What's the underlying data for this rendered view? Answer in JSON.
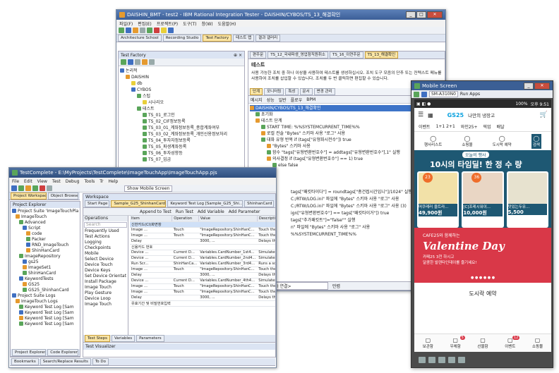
{
  "rit": {
    "title": "DAISHIN_BMT - test2 - IBM Rational Integration Tester - DAISHIN/CYBOS/TS_13_해결확인",
    "menu": [
      "파일(F)",
      "편집(E)",
      "프로젝트(P)",
      "도구(T)",
      "창(W)",
      "도움말(H)"
    ],
    "perspectives": [
      "Architecture School",
      "Recording Studio",
      "Test Factory",
      "테스트 랩",
      "결과 갤러리"
    ],
    "panel_title": "Test Factory",
    "tree": [
      "논리적",
      "DAISHIN",
      "db",
      "CYBOS",
      "스텁",
      "시나리오",
      "테스트",
      "TS_01_로그인",
      "TS_02_CIF정보등록",
      "TS_03_01_계좌정보등록_종합계좌여부",
      "TS_03_02_계좌정보등록_개인신용정보처리",
      "TS_04_투자자정보등록",
      "TS_05_파생계좌등록",
      "TS_06_투자성향등",
      "TS_07_입금"
    ],
    "doc_tabs": [
      "편주문",
      "TS_12_국내파생_영업점직원취소",
      "TS_16_이연주문",
      "TS_13_해결확인"
    ],
    "section_title": "테스트",
    "description": "사용 가능한 조치 중 하나 이상을 사용하여 테스트를 생성하십시오. 조치 도구 모음의 단추 또는 컨텍스트 메뉴를 사용하여 조치를 삽입할 수 있습니다. 조치를 두 번 클릭하면 편집할 수 있습니다.",
    "inner_tabs": [
      "단계",
      "모니터링",
      "특성",
      "문서",
      "변경 관리"
    ],
    "step_toolbar": [
      "메시지",
      "성능",
      "일반",
      "플로우",
      "BPM"
    ],
    "steps": [
      "DAISHIN/CYBOS/TS_13_해결확인",
      "초기화",
      "테스트 단계",
      "START TIME: %%SYSTEMCURRENT_TIME%%",
      "로컬 컨솔 \"Bytes\" 스키마 사용 \"로그\" 사용",
      "대화 유형 반복 if (tags[\"유형화시전수\"]) true",
      "\"Bytes\" 스키마 사용",
      "함수 \"tags[\"유형변환번호수\"] = addtags[\"유형변환번호수\"],1\" 실행",
      "의사결정 if (tags[\"유형변환번호수\"] == 1) true",
      "else false"
    ],
    "steps_right": [
      "tags[\"패킷타이다\"] = roundtags[\"총건접시간입니\"]/1024\" 실행",
      "C:/RTW/LOG.ini\" 파일에 \"Bytes\" 스키마 사용 \"로그\" 사용",
      "C:/RTW/LOG.ini\" 파일에 \"Bytes\" 스키마 사용 \"로그\" 사용 (3)",
      "ign[\"유형변환번호수\"] == tags[\"패킷타이거\"]) true",
      "tags[\"추가패킷트\"]=\"false\"\" 실행",
      "n\" 파일에 \"Bytes\" 스키마 사용 \"로그\" 사용",
      "%%SYSTEMCURRENT_TIME%%"
    ],
    "status_combo": "<테스트 추가 연결>",
    "status_right": "만렴"
  },
  "tc": {
    "title": "TestComplete - E:\\MyProjects\\TestComplete\\ImageTouchApp\\ImageTouchApp.pjs",
    "menu": [
      "File",
      "Edit",
      "View",
      "Test",
      "Debug",
      "Tools",
      "Tr",
      "Help"
    ],
    "left_tabs": [
      "Project Workspace",
      "Object Browser"
    ],
    "explorer_title": "Project Explorer",
    "tree": [
      "Project Suite 'ImageTouchPlay'",
      "ImageTouch",
      "Advanced",
      "Script",
      "code",
      "Packer",
      "RND_ImageTouch",
      "ShinHanCard",
      "ImageRepository",
      "gs25",
      "ImageSet1",
      "ShinHanCard",
      "KeywordTests",
      "GS25",
      "GS25_ShinhanCard",
      "Project Suite Logs",
      "ImageTouch Logs",
      "Keyword Test Log [Sam",
      "Keyword Test Log [Sam",
      "Keyword Test Log [Sam",
      "Keyword Test Log [Sam"
    ],
    "left_bottom_tabs": [
      "Project Explorer",
      "Code Explorer"
    ],
    "footer_tabs": [
      "Bookmarks",
      "Search/Replace Results",
      "To Do"
    ],
    "workspace_title": "Workspace",
    "doc_tabs": [
      "Start Page",
      "Sample_G25_ShinhanCard",
      "Keyword Test Log [Sample_G25_Shi...",
      "ShinhanCard"
    ],
    "toolbar": [
      "Append to Test",
      "Run Test",
      "Add Variable",
      "Add Parameter"
    ],
    "operations_title": "Operations",
    "search_placeholder": "Search",
    "operations": [
      "Frequently Used",
      "Test Actions",
      "Logging",
      "Checkpoints",
      "Mobile",
      "Select Device",
      "Device Touch",
      "Device Keys",
      "Set Device Orientation",
      "Install Package",
      "Image Touch",
      "Play Gesture",
      "Device Loop",
      "Image Touch"
    ],
    "columns": [
      "Item",
      "Operation",
      "Value",
      "Description"
    ],
    "rows": [
      [
        "신한카드(CI)화면창",
        "",
        "",
        ""
      ],
      [
        "Image ...",
        "Touch",
        "\"ImageRepository.ShinHanC...",
        "Touch the image on mobile ..."
      ],
      [
        "Image ...",
        "Touch",
        "\"ImageRepository.ShinHanC...",
        "Touch the image on mobile ..."
      ],
      [
        "Delay",
        "",
        "3000, ...",
        "Delays the test execution fo..."
      ],
      [
        "신용카드 번호",
        "",
        "",
        ""
      ],
      [
        "Device ...",
        "Current D...",
        "Variables.CardNumber_1st4...",
        "Simulates keystrokes on the ..."
      ],
      [
        "Device ...",
        "Current D...",
        "Variables.CardNumber_2nd4...",
        "Simulates keystrokes on the ..."
      ],
      [
        "Run Scr...",
        "ShinHanCa...",
        "Variables.CardNumber_3rd4...",
        "Runs a script routine."
      ],
      [
        "Image ...",
        "Touch",
        "\"ImageRepository.ShinHanC...",
        "Touch the image on mobile ..."
      ],
      [
        "Delay",
        "",
        "3000, ...",
        "Delays the test execution fo..."
      ],
      [
        "Device ...",
        "Current D...",
        "Variables.CardNumber_4th4...",
        "Simulates keystrokes on the ..."
      ],
      [
        "Image ...",
        "Touch",
        "\"ImageRepository.ShinHanC...",
        "Touch the image on mobile ..."
      ],
      [
        "Image ...",
        "Touch",
        "\"ImageRepository.ShinHanC...",
        "Touch the image on mobile ..."
      ],
      [
        "Delay",
        "",
        "3000, ...",
        "Delays the test execution fo..."
      ],
      [
        "유효기간 및 비밀번호입력",
        "",
        "",
        ""
      ]
    ],
    "bottom_tabs": [
      "Test Steps",
      "Variables",
      "Parameters"
    ],
    "visualizer_title": "Test Visualizer",
    "mobile_screen_label": "Show Mobile Screen"
  },
  "mobile": {
    "title": "Mobile Screen",
    "device": "SM-A310N0",
    "run_apps": "Run Apps",
    "status_time": "오후 9:51",
    "status_battery": "100%",
    "brand": "GS25",
    "tagline": "나만의 냉장고",
    "nav": [
      "이벤트",
      "1+1 2+1",
      "와인25+",
      "픽업",
      "배달"
    ],
    "icons": [
      "행사리스트",
      "쇼핑몰",
      "도시락 예약",
      "검색"
    ],
    "banner_tag": "오늘의 행사",
    "banner_title": "10시의 타임딜! 한 정 수 량",
    "badges": [
      "23",
      "36"
    ],
    "products": [
      {
        "name": "머쿠레러 울트라...",
        "old": "",
        "price": "49,900원"
      },
      {
        "name": "[C]프레시워이...",
        "old": "",
        "price": "10,000원"
      },
      {
        "name": "맛있는두유...",
        "old": "",
        "price": "5,500"
      }
    ],
    "cafe": "CAFE25와 함께하는",
    "valentine": "Valentine Day",
    "val_sub1": "카페25 3천 하시고",
    "val_sub2": "달콤한 발렌타인데이를 즐기세요!",
    "section": "도시락 예약",
    "bottom_nav": [
      "보관함",
      "우체함",
      "선물함",
      "이벤트",
      "쇼핑몰"
    ],
    "bottom_badges": [
      "5",
      "12"
    ],
    "colors": {
      "brand": "#0aa1df",
      "valentine": "#d93848"
    }
  }
}
